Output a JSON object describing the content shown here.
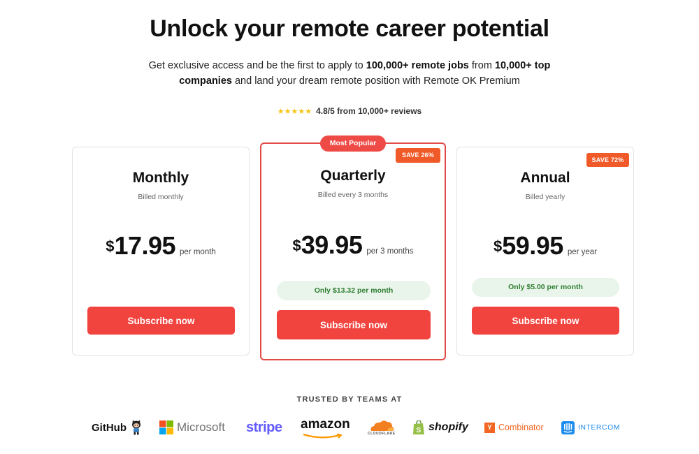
{
  "hero": {
    "headline": "Unlock your remote career potential",
    "subtitle_parts": {
      "p1": "Get exclusive access and be the first to apply to ",
      "b1": "100,000+ remote jobs",
      "p2": " from ",
      "b2": "10,000+ top companies",
      "p3": " and land your dream remote position with Remote OK Premium"
    },
    "rating": {
      "stars": "★★★★★",
      "text": "4.8/5 from 10,000+ reviews",
      "star_color": "#f5c518"
    }
  },
  "plans": [
    {
      "name": "Monthly",
      "billing": "Billed monthly",
      "currency": "$",
      "amount": "17.95",
      "period": "per month",
      "cta": "Subscribe now"
    },
    {
      "name": "Quarterly",
      "billing": "Billed every 3 months",
      "currency": "$",
      "amount": "39.95",
      "period": "per 3 months",
      "badge_popular": "Most Popular",
      "badge_save": "SAVE 26%",
      "savings": "Only $13.32 per month",
      "cta": "Subscribe now"
    },
    {
      "name": "Annual",
      "billing": "Billed yearly",
      "currency": "$",
      "amount": "59.95",
      "period": "per year",
      "badge_save": "SAVE 72%",
      "savings": "Only $5.00 per month",
      "cta": "Subscribe now"
    }
  ],
  "trusted": {
    "label": "TRUSTED BY TEAMS AT",
    "logos": {
      "github": "GitHub",
      "microsoft": "Microsoft",
      "stripe": "stripe",
      "amazon": "amazon",
      "cloudflare": "CLOUDFLARE",
      "shopify": "shopify",
      "ycombinator_y": "Y",
      "ycombinator": "Combinator",
      "intercom": "INTERCOM"
    }
  },
  "colors": {
    "accent": "#f1443f",
    "featured_border": "#e24a48",
    "save_badge": "#f05a28",
    "savings_bg": "#e9f5ea",
    "savings_text": "#2e7d32"
  }
}
